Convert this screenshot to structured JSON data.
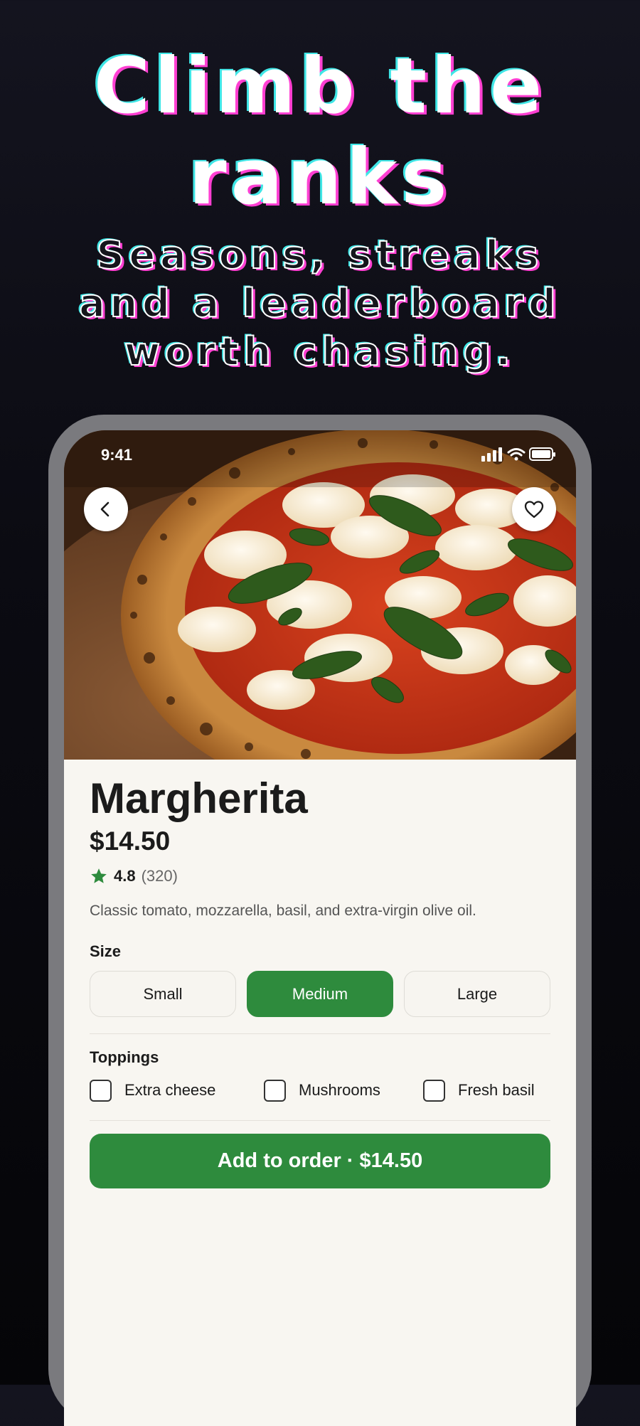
{
  "promo": {
    "headline_line1": "Climb the",
    "headline_line2": "ranks",
    "subline_1": "Seasons, streaks",
    "subline_2": "and a leaderboard",
    "subline_3": "worth chasing."
  },
  "status_bar": {
    "time": "9:41",
    "icons": [
      "signal-icon",
      "wifi-icon",
      "battery-icon"
    ]
  },
  "header": {
    "back_icon": "chevron-left-icon",
    "favorite_icon": "heart-icon",
    "image": "margherita-pizza-photo"
  },
  "product": {
    "name": "Margherita",
    "price": "$14.50",
    "rating": "4.8",
    "rating_count": "(320)",
    "description": "Classic tomato, mozzarella, basil, and extra-virgin olive oil."
  },
  "size": {
    "label": "Size",
    "options": [
      "Small",
      "Medium",
      "Large"
    ],
    "selected": "Medium"
  },
  "toppings": {
    "label": "Toppings",
    "options": [
      "Extra cheese",
      "Mushrooms",
      "Fresh basil"
    ]
  },
  "cta": {
    "label": "Add to order · $14.50"
  },
  "colors": {
    "accent": "#2e8b3d",
    "background": "#0b0b12",
    "sheet": "#f8f6f1",
    "headline_cyan": "#3fe6e6",
    "headline_magenta": "#ff3fd2"
  }
}
